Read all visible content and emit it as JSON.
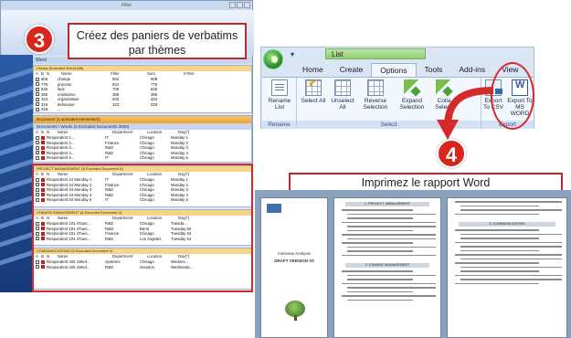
{
  "app": {
    "title": "Filter",
    "left_tab": "Word",
    "library_header": "Library (Excluded Word) (88)",
    "word_columns": [
      "A",
      "B",
      "N",
      "Name",
      "Filter",
      "Sum",
      "InText"
    ],
    "words": [
      {
        "n": "806",
        "name": "change",
        "sum": "852",
        "intext": "809"
      },
      {
        "n": "779",
        "name": "process",
        "sum": "824",
        "intext": "779"
      },
      {
        "n": "626",
        "name": "lack",
        "sum": "705",
        "intext": "626"
      },
      {
        "n": "365",
        "name": "resistance",
        "sum": "385",
        "intext": "365"
      },
      {
        "n": "323",
        "name": "organization",
        "sum": "332",
        "intext": "323"
      },
      {
        "n": "319",
        "name": "behaviour",
        "sum": "323",
        "intext": "319"
      },
      {
        "n": "318",
        "name": "...",
        "sum": "",
        "intext": ""
      }
    ],
    "documents_bar": "Document (2 activated elements/2)",
    "documents_header": "Documents / Words (2 Excluded Documents 3000)",
    "doc_columns": [
      "A",
      "B",
      "N",
      "Name",
      "Department",
      "Location",
      "Day(*)"
    ],
    "documents": [
      {
        "name": "Respondent 1...",
        "dept": "IT",
        "loc": "Chicago",
        "day": "Monday 1"
      },
      {
        "name": "Respondent 2...",
        "dept": "Finance",
        "loc": "Chicago",
        "day": "Monday 2"
      },
      {
        "name": "Respondent 3...",
        "dept": "R&D",
        "loc": "Chicago",
        "day": "Monday 3"
      },
      {
        "name": "Respondent 4...",
        "dept": "R&D",
        "loc": "Chicago",
        "day": "Monday 4"
      },
      {
        "name": "Respondent 5...",
        "dept": "IT",
        "loc": "Chicago",
        "day": "Monday 5"
      }
    ],
    "basket1_header": "PROJECT MANAGEMENT (8 Excluded Document 5)",
    "basket1_rows": [
      {
        "name": "Respondent 14 Monday 1",
        "dept": "IT",
        "loc": "Chicago",
        "day": "Monday 1"
      },
      {
        "name": "Respondent 24 Monday 2",
        "dept": "Finance",
        "loc": "Chicago",
        "day": "Monday 2"
      },
      {
        "name": "Respondent 34 Monday 3",
        "dept": "R&D",
        "loc": "Chicago",
        "day": "Monday 3"
      },
      {
        "name": "Respondent 44 Monday 4",
        "dept": "R&D",
        "loc": "Chicago",
        "day": "Monday 4"
      },
      {
        "name": "Respondent 54 Monday 5",
        "dept": "IT",
        "loc": "Chicago",
        "day": "Monday 5"
      }
    ],
    "basket2_header": "CHANGE MANAGEMENT (8 Excluded Document 4)",
    "basket2_rows": [
      {
        "name": "Respondent 101 4Tues...",
        "dept": "R&D",
        "loc": "Chicago",
        "day": "Tuesda..."
      },
      {
        "name": "Respondent 101 4Tues...",
        "dept": "R&D",
        "loc": "Bend",
        "day": "Tuesday 62"
      },
      {
        "name": "Respondent 101 4Tues...",
        "dept": "Finance",
        "loc": "Chicago",
        "day": "Tuesday 63"
      },
      {
        "name": "Respondent 101 4Tues...",
        "dept": "R&D",
        "loc": "Los Angeles",
        "day": "Tuesday 64"
      }
    ],
    "basket3_header": "COMMUNICATIONS (8 Excluded Document 2)",
    "basket3_rows": [
      {
        "name": "Respondent 425 1Wed...",
        "dept": "Systems",
        "loc": "Chicago",
        "day": "Wednes..."
      },
      {
        "name": "Respondent 425 1Wed...",
        "dept": "R&D",
        "loc": "Houston",
        "day": "Wednesda..."
      }
    ]
  },
  "steps": {
    "step3_number": "3",
    "step3_text": "Créez des paniers de verbatims par thèmes",
    "step4_number": "4",
    "step4_text": "Imprimez le rapport Word"
  },
  "ribbon": {
    "quick_access": "▾",
    "context_tab": "List",
    "tabs": [
      "Home",
      "Create",
      "Options",
      "Tools",
      "Add-ins",
      "View"
    ],
    "active_tab": "Options",
    "buttons": {
      "rename_list": "Rename List",
      "select_all": "Select All",
      "unselect_all": "Unselect All",
      "reverse_selection": "Reverse Selection",
      "expand_selection": "Expand Selection",
      "collapse_selection": "Colla Selecti",
      "export_csv": "Export To CSV",
      "export_word": "Export To MS WORD"
    },
    "groups": {
      "rename": "Rename",
      "select": "Select",
      "export": "Export"
    }
  },
  "report": {
    "cover_title": "Interview Analysis",
    "cover_subtitle": "DRAFT VERSION V0",
    "section1": "1. PROJECT MANAGEMENT",
    "section2": "2. CHANGE MANAGEMENT",
    "section3": "3. COMMUNICATIONS"
  },
  "colors": {
    "accent_red": "#d62a2a",
    "ribbon_green": "#8fcf6f",
    "panel_orange": "#f0a230"
  }
}
